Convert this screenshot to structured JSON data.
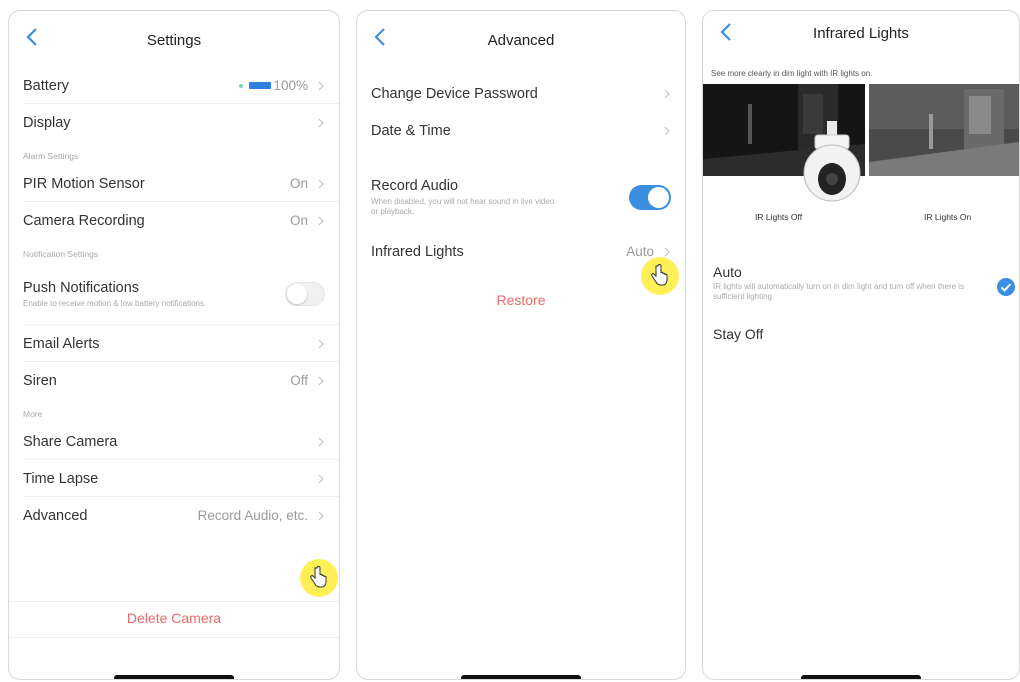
{
  "screens": {
    "settings": {
      "title": "Settings",
      "battery": {
        "label": "Battery",
        "value": "100%"
      },
      "display": {
        "label": "Display"
      },
      "alarm_section": "Alarm Settings",
      "pir": {
        "label": "PIR Motion Sensor",
        "value": "On"
      },
      "camera_recording": {
        "label": "Camera Recording",
        "value": "On"
      },
      "notification_section": "Notification Settings",
      "push": {
        "label": "Push Notifications",
        "desc": "Enable to receive motion & low battery notifications.",
        "enabled": false
      },
      "email": {
        "label": "Email Alerts"
      },
      "siren": {
        "label": "Siren",
        "value": "Off"
      },
      "more_section": "More",
      "share": {
        "label": "Share Camera"
      },
      "timelapse": {
        "label": "Time Lapse"
      },
      "advanced": {
        "label": "Advanced",
        "value": "Record Audio, etc."
      },
      "delete": "Delete Camera"
    },
    "advanced": {
      "title": "Advanced",
      "password": {
        "label": "Change Device Password"
      },
      "datetime": {
        "label": "Date & Time"
      },
      "record_audio": {
        "label": "Record Audio",
        "desc": "When disabled, you will not hear sound in live video or playback.",
        "enabled": true
      },
      "infrared": {
        "label": "Infrared Lights",
        "value": "Auto"
      },
      "restore": "Restore"
    },
    "infrared": {
      "title": "Infrared Lights",
      "intro": "See more clearly in dim light with IR lights on.",
      "caption_off": "IR Lights Off",
      "caption_on": "IR Lights On",
      "auto": {
        "label": "Auto",
        "desc": "IR lights will automatically turn on in dim light and turn off when there is sufficient lighting.",
        "selected": true
      },
      "stay_off": {
        "label": "Stay Off"
      }
    }
  },
  "colors": {
    "accent": "#3a8fe0",
    "danger": "#e86a6a",
    "highlight": "#ffee46"
  }
}
